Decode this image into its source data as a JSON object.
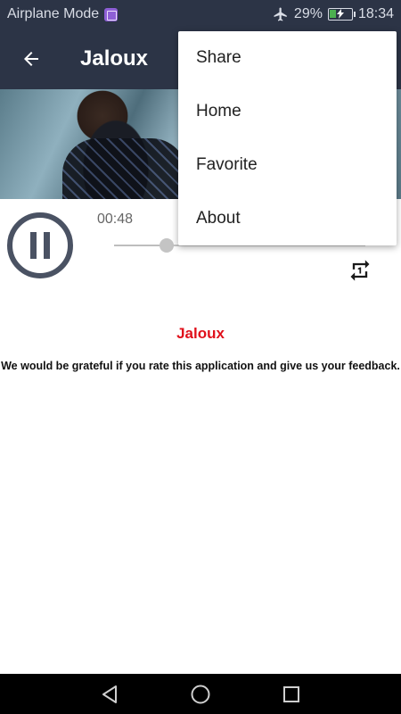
{
  "status_bar": {
    "mode_label": "Airplane Mode",
    "battery_percent": "29%",
    "battery_level": 0.29,
    "time": "18:34",
    "icons": [
      "gallery-badge-icon",
      "airplane-icon",
      "battery-charging-icon"
    ]
  },
  "app_bar": {
    "title": "Jaloux",
    "back_icon": "arrow-left-icon"
  },
  "player": {
    "elapsed": "00:48",
    "progress": 0.21,
    "state_icon": "pause-icon",
    "repeat_icon": "repeat-one-icon"
  },
  "content": {
    "song_title": "Jaloux",
    "message": "We would be grateful if you rate this application and give us your feedback."
  },
  "menu": {
    "items": [
      {
        "label": "Share"
      },
      {
        "label": "Home"
      },
      {
        "label": "Favorite"
      },
      {
        "label": "About"
      }
    ]
  },
  "nav_bar": {
    "icons": [
      "back-triangle-icon",
      "home-circle-icon",
      "recents-square-icon"
    ]
  },
  "colors": {
    "bar_background": "#2c3446",
    "accent_red": "#e0101b",
    "pause_gray": "#4a5263"
  }
}
